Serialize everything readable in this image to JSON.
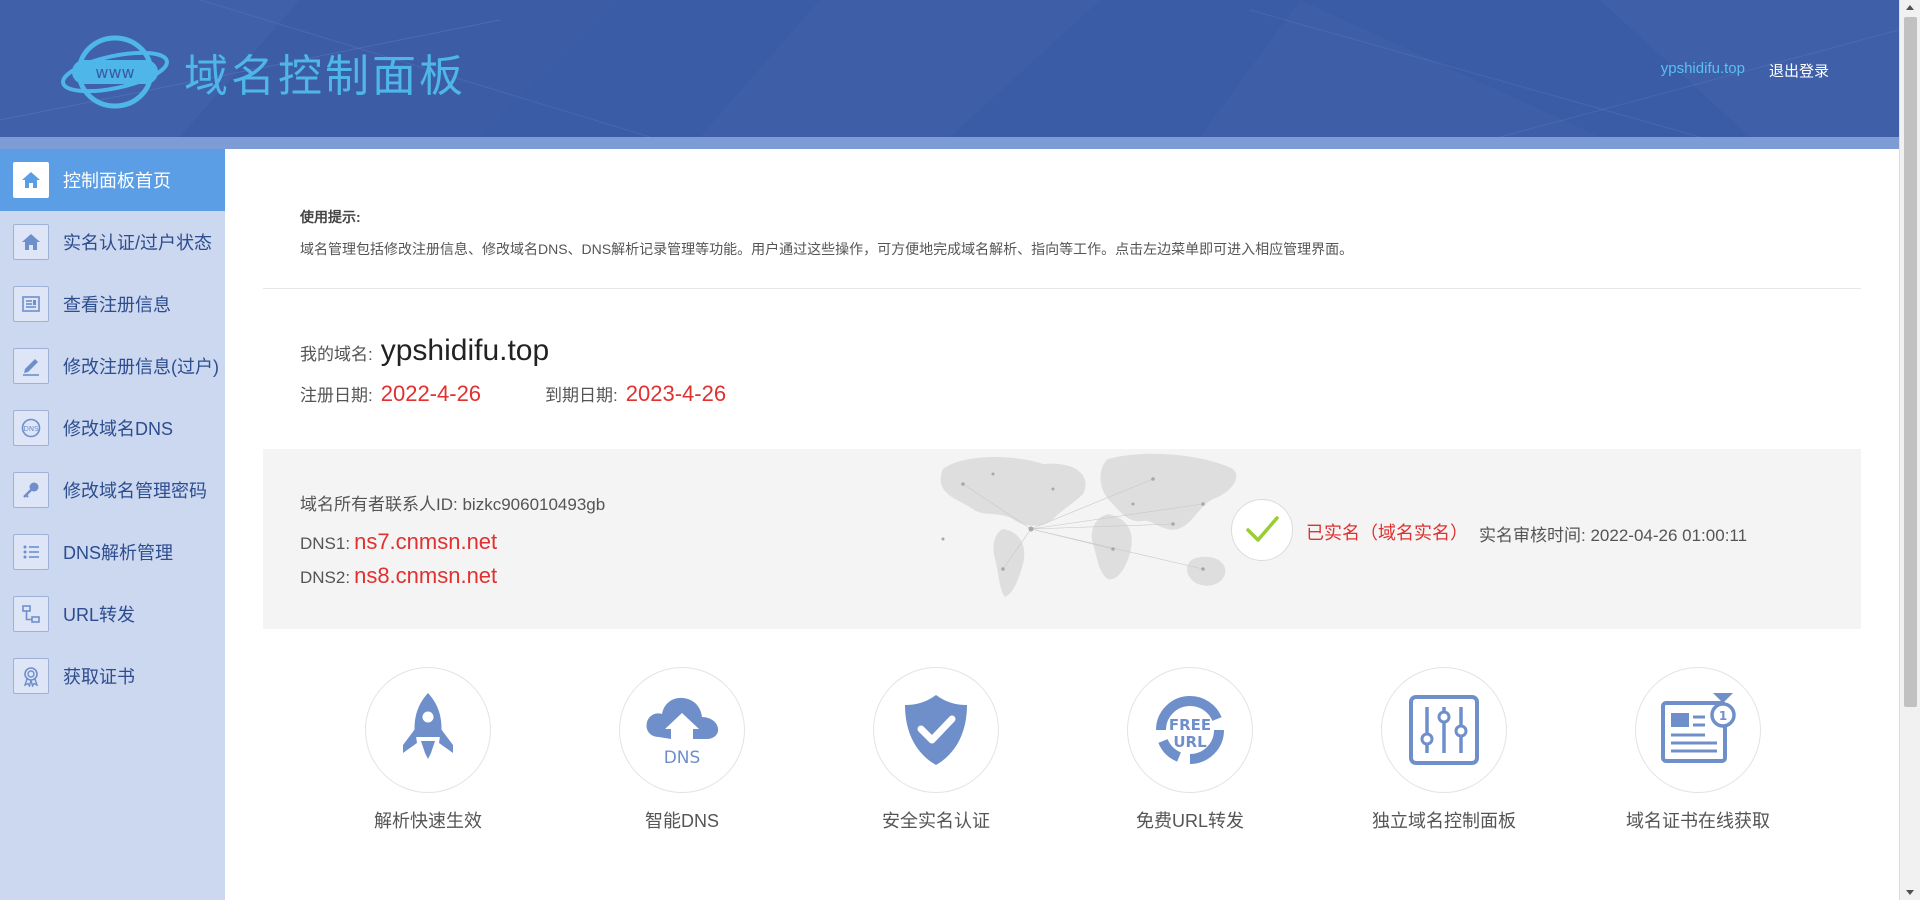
{
  "header": {
    "title": "域名控制面板",
    "logo_text": "www",
    "user": "ypshidifu.top",
    "logout": "退出登录"
  },
  "sidebar": {
    "items": [
      {
        "label": "控制面板首页",
        "icon": "home-icon",
        "active": true
      },
      {
        "label": "实名认证/过户状态",
        "icon": "home-icon",
        "active": false
      },
      {
        "label": "查看注册信息",
        "icon": "document-icon",
        "active": false
      },
      {
        "label": "修改注册信息(过户)",
        "icon": "pencil-icon",
        "active": false
      },
      {
        "label": "修改域名DNS",
        "icon": "dns-icon",
        "active": false
      },
      {
        "label": "修改域名管理密码",
        "icon": "key-icon",
        "active": false
      },
      {
        "label": "DNS解析管理",
        "icon": "list-icon",
        "active": false
      },
      {
        "label": "URL转发",
        "icon": "network-icon",
        "active": false
      },
      {
        "label": "获取证书",
        "icon": "certificate-icon",
        "active": false
      }
    ]
  },
  "tips": {
    "title": "使用提示:",
    "text": "域名管理包括修改注册信息、修改域名DNS、DNS解析记录管理等功能。用户通过这些操作，可方便地完成域名解析、指向等工作。点击左边菜单即可进入相应管理界面。"
  },
  "domain": {
    "label": "我的域名:",
    "value": "ypshidifu.top",
    "reg_label": "注册日期:",
    "reg_date": "2022-4-26",
    "exp_label": "到期日期:",
    "exp_date": "2023-4-26"
  },
  "info": {
    "owner_label": "域名所有者联系人ID:",
    "owner_id": "bizkc906010493gb",
    "dns1_label": "DNS1:",
    "dns1": "ns7.cnmsn.net",
    "dns2_label": "DNS2:",
    "dns2": "ns8.cnmsn.net",
    "verify_status": "已实名（域名实名）",
    "verify_time_label": "实名审核时间:",
    "verify_time": "2022-04-26 01:00:11"
  },
  "features": [
    {
      "label": "解析快速生效",
      "icon": "rocket-icon"
    },
    {
      "label": "智能DNS",
      "icon": "cloud-upload-icon",
      "icon_text": "DNS"
    },
    {
      "label": "安全实名认证",
      "icon": "shield-check-icon"
    },
    {
      "label": "免费URL转发",
      "icon": "free-url-icon",
      "icon_text_1": "FREE",
      "icon_text_2": "URL"
    },
    {
      "label": "独立域名控制面板",
      "icon": "sliders-icon"
    },
    {
      "label": "域名证书在线获取",
      "icon": "certificate-icon"
    }
  ],
  "colors": {
    "header_bg": "#3a5ba5",
    "sidebar_bg": "#ccd7f0",
    "sidebar_active": "#5b9ee6",
    "accent_red": "#e03030",
    "icon_blue": "#6f8fcb"
  }
}
